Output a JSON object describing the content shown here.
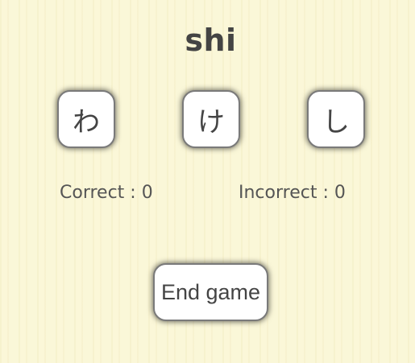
{
  "prompt": "shi",
  "choices": [
    {
      "label": "わ"
    },
    {
      "label": "け"
    },
    {
      "label": "し"
    }
  ],
  "score": {
    "correct_text": "Correct : 0",
    "incorrect_text": "Incorrect : 0"
  },
  "end_button_label": "End game",
  "colors": {
    "background": "#faf6d6",
    "text": "#444444",
    "card": "#ffffff",
    "border": "#7a7a7a"
  }
}
